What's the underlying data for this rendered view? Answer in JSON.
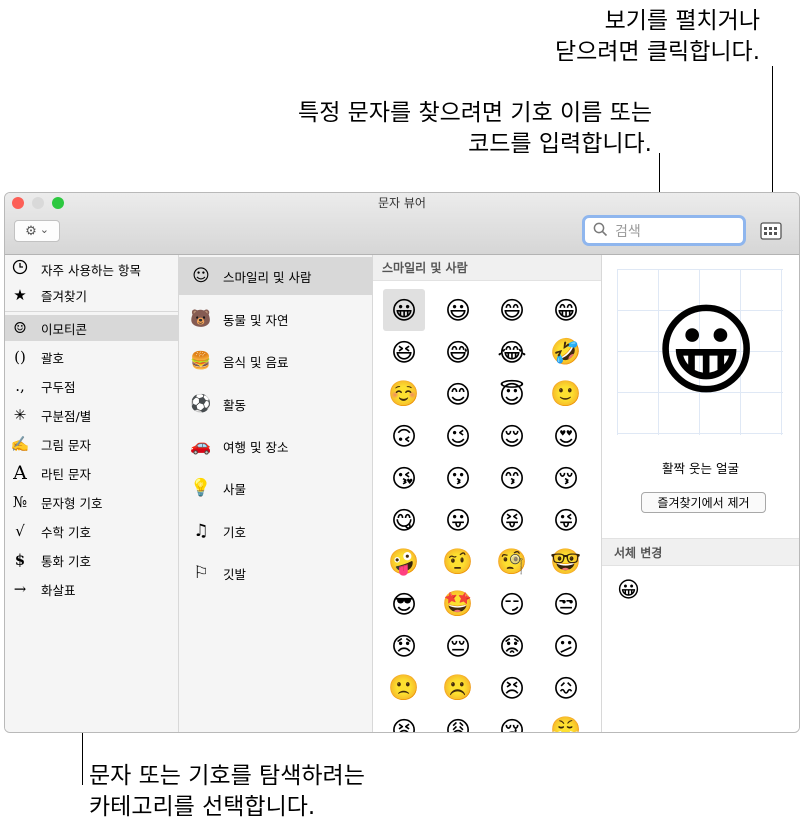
{
  "callouts": {
    "view_toggle": [
      "보기를 펼치거나",
      "닫으려면 클릭합니다."
    ],
    "search": [
      "특정 문자를 찾으려면 기호 이름 또는",
      "코드를 입력합니다."
    ],
    "categories": [
      "문자 또는 기호를 탐색하려는",
      "카테고리를 선택합니다."
    ]
  },
  "window": {
    "title": "문자 뷰어",
    "traffic_lights": {
      "close": "#fc5f57",
      "minimize": "#d9d9d9",
      "zoom": "#2dc840"
    }
  },
  "toolbar": {
    "gear_icon": "⚙",
    "gear_chevron": "⌄",
    "search_placeholder": "검색",
    "search_icon": "magnifying-glass-icon",
    "view_toggle_icon": "keyboard-grid-icon"
  },
  "sidebar": {
    "items": [
      {
        "icon": "🕘",
        "label": "자주 사용하는 항목"
      },
      {
        "icon": "★",
        "label": "즐겨찾기"
      },
      {
        "icon": "☺",
        "label": "이모티콘"
      },
      {
        "icon": "()",
        "label": "괄호"
      },
      {
        "icon": ".,",
        "label": "구두점"
      },
      {
        "icon": "✳",
        "label": "구분점/별"
      },
      {
        "icon": "✍",
        "label": "그림 문자"
      },
      {
        "icon": "A",
        "label": "라틴 문자"
      },
      {
        "icon": "№",
        "label": "문자형 기호"
      },
      {
        "icon": "√",
        "label": "수학 기호"
      },
      {
        "icon": "$",
        "label": "통화 기호"
      },
      {
        "icon": "→",
        "label": "화살표"
      }
    ]
  },
  "subcategories": {
    "items": [
      {
        "icon": "☺",
        "label": "스마일리 및 사람"
      },
      {
        "icon": "🐻",
        "label": "동물 및 자연"
      },
      {
        "icon": "🍔",
        "label": "음식 및 음료"
      },
      {
        "icon": "⚽",
        "label": "활동"
      },
      {
        "icon": "🚗",
        "label": "여행 및 장소"
      },
      {
        "icon": "💡",
        "label": "사물"
      },
      {
        "icon": "♫",
        "label": "기호"
      },
      {
        "icon": "⚐",
        "label": "깃발"
      }
    ]
  },
  "grid": {
    "header": "스마일리 및 사람",
    "emojis": [
      "😀",
      "😃",
      "😄",
      "😁",
      "😆",
      "😅",
      "😂",
      "🤣",
      "☺️",
      "😊",
      "😇",
      "🙂",
      "🙃",
      "😉",
      "😌",
      "😍",
      "😘",
      "😗",
      "😙",
      "😚",
      "😋",
      "😛",
      "😝",
      "😜",
      "🤪",
      "🤨",
      "🧐",
      "🤓",
      "😎",
      "🤩",
      "😏",
      "😒",
      "😞",
      "😔",
      "😟",
      "😕",
      "🙁",
      "☹️",
      "😣",
      "😖",
      "😫",
      "😩",
      "😢",
      "😤"
    ]
  },
  "detail": {
    "emoji": "😀",
    "name": "활짝 웃는 얼굴",
    "remove_favorite_label": "즐겨찾기에서 제거",
    "font_variation_header": "서체 변경",
    "font_variation_emoji": "😀"
  }
}
